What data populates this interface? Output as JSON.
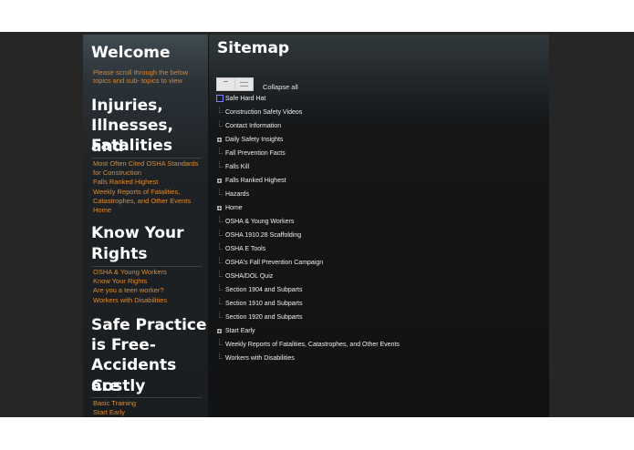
{
  "sidebar": {
    "welcome": {
      "heading": "Welcome",
      "sub": [
        "Please scroll through the below",
        "topics and sub- topics to view"
      ]
    },
    "injuries": {
      "heading": [
        "Injuries,",
        "Illnesses, and",
        "Fatalities"
      ],
      "links": [
        "Most Often Cited OSHA Standards",
        "for Construction",
        "Falls Ranked Highest",
        "Weekly Reports of Fatalities,",
        "Catastrophes, and Other Events",
        "Home"
      ]
    },
    "rights": {
      "heading": [
        "Know Your",
        "Rights"
      ],
      "links": [
        "OSHA & Young Workers",
        "Know Your Rights",
        "Are you a teen worker?",
        "Workers with Disabilities"
      ]
    },
    "safe": {
      "heading": [
        "Safe Practice",
        "is Free-",
        "Accidents are",
        "Costly"
      ],
      "links": [
        "Basic Training",
        "Start Early"
      ]
    }
  },
  "main": {
    "title": "Sitemap",
    "collapse_all": "Collapse all",
    "tree": [
      {
        "label": "Safe Hard Hat",
        "marker": "checkbox"
      },
      {
        "label": "Construction Safety Videos",
        "marker": "branch"
      },
      {
        "label": "Contact Information",
        "marker": "branch"
      },
      {
        "label": "Daily Safety Insights",
        "marker": "plus"
      },
      {
        "label": "Fall Prevention Facts",
        "marker": "branch"
      },
      {
        "label": "Falls Kill",
        "marker": "branch"
      },
      {
        "label": "Falls Ranked Highest",
        "marker": "plus"
      },
      {
        "label": "Hazards",
        "marker": "branch"
      },
      {
        "label": "Home",
        "marker": "plus"
      },
      {
        "label": "OSHA & Young Workers",
        "marker": "branch"
      },
      {
        "label": "OSHA 1910.28 Scaffolding",
        "marker": "branch"
      },
      {
        "label": "OSHA E Tools",
        "marker": "branch"
      },
      {
        "label": "OSHA's Fall Prevention Campaign",
        "marker": "branch"
      },
      {
        "label": "OSHA/DOL Quiz",
        "marker": "branch"
      },
      {
        "label": "Section 1904 and Subparts",
        "marker": "branch"
      },
      {
        "label": "Section 1910 and Subparts",
        "marker": "branch"
      },
      {
        "label": "Section 1920 and Subparts",
        "marker": "branch"
      },
      {
        "label": "Start Early",
        "marker": "plus"
      },
      {
        "label": "Weekly Reports of Fatalities, Catastrophes, and Other Events",
        "marker": "branch"
      },
      {
        "label": "Workers with Disabilities",
        "marker": "branch"
      }
    ]
  },
  "colors": {
    "link": "#e08a2e",
    "checkbox_border": "#7b84ff",
    "background": "#262626"
  }
}
